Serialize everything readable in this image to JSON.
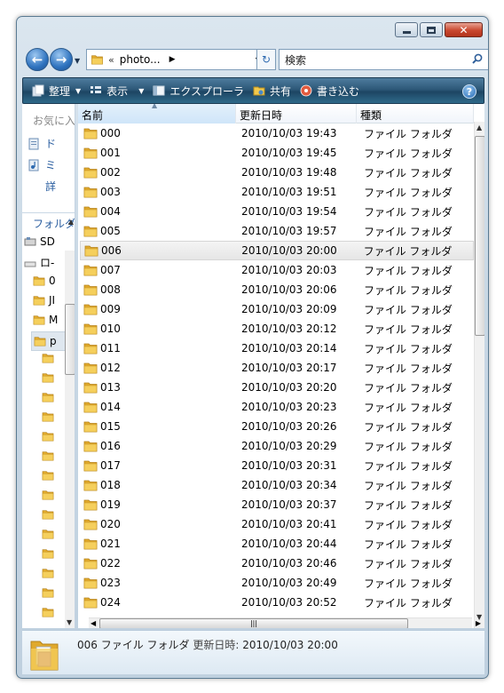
{
  "window": {
    "caption_buttons": [
      "minimize-icon",
      "maximize-icon",
      "close-icon"
    ]
  },
  "nav": {
    "address_chevron": "«",
    "address_path": "photo...",
    "search_placeholder": "検索"
  },
  "toolbar": {
    "organize": "整理",
    "views": "表示",
    "explorer": "エクスプローラ",
    "share": "共有",
    "burn": "書き込む",
    "help": "?"
  },
  "left": {
    "favorites_head": "お気に入",
    "favorites": [
      {
        "label": "ド",
        "icon": "documents-icon"
      },
      {
        "label": "ミ",
        "icon": "music-icon"
      },
      {
        "label": "詳",
        "icon": ""
      }
    ],
    "folders_head": "フォルダ",
    "tree": [
      {
        "label": "SD"
      },
      {
        "label": "ロ-"
      },
      {
        "label": "0"
      },
      {
        "label": "JI"
      },
      {
        "label": "M"
      },
      {
        "label": "p"
      }
    ]
  },
  "columns": {
    "name": "名前",
    "date": "更新日時",
    "type": "種類"
  },
  "rows": [
    {
      "name": "000",
      "date": "2010/10/03 19:43",
      "type": "ファイル フォルダ"
    },
    {
      "name": "001",
      "date": "2010/10/03 19:45",
      "type": "ファイル フォルダ"
    },
    {
      "name": "002",
      "date": "2010/10/03 19:48",
      "type": "ファイル フォルダ"
    },
    {
      "name": "003",
      "date": "2010/10/03 19:51",
      "type": "ファイル フォルダ"
    },
    {
      "name": "004",
      "date": "2010/10/03 19:54",
      "type": "ファイル フォルダ"
    },
    {
      "name": "005",
      "date": "2010/10/03 19:57",
      "type": "ファイル フォルダ"
    },
    {
      "name": "006",
      "date": "2010/10/03 20:00",
      "type": "ファイル フォルダ",
      "selected": true
    },
    {
      "name": "007",
      "date": "2010/10/03 20:03",
      "type": "ファイル フォルダ"
    },
    {
      "name": "008",
      "date": "2010/10/03 20:06",
      "type": "ファイル フォルダ"
    },
    {
      "name": "009",
      "date": "2010/10/03 20:09",
      "type": "ファイル フォルダ"
    },
    {
      "name": "010",
      "date": "2010/10/03 20:12",
      "type": "ファイル フォルダ"
    },
    {
      "name": "011",
      "date": "2010/10/03 20:14",
      "type": "ファイル フォルダ"
    },
    {
      "name": "012",
      "date": "2010/10/03 20:17",
      "type": "ファイル フォルダ"
    },
    {
      "name": "013",
      "date": "2010/10/03 20:20",
      "type": "ファイル フォルダ"
    },
    {
      "name": "014",
      "date": "2010/10/03 20:23",
      "type": "ファイル フォルダ"
    },
    {
      "name": "015",
      "date": "2010/10/03 20:26",
      "type": "ファイル フォルダ"
    },
    {
      "name": "016",
      "date": "2010/10/03 20:29",
      "type": "ファイル フォルダ"
    },
    {
      "name": "017",
      "date": "2010/10/03 20:31",
      "type": "ファイル フォルダ"
    },
    {
      "name": "018",
      "date": "2010/10/03 20:34",
      "type": "ファイル フォルダ"
    },
    {
      "name": "019",
      "date": "2010/10/03 20:37",
      "type": "ファイル フォルダ"
    },
    {
      "name": "020",
      "date": "2010/10/03 20:41",
      "type": "ファイル フォルダ"
    },
    {
      "name": "021",
      "date": "2010/10/03 20:44",
      "type": "ファイル フォルダ"
    },
    {
      "name": "022",
      "date": "2010/10/03 20:46",
      "type": "ファイル フォルダ"
    },
    {
      "name": "023",
      "date": "2010/10/03 20:49",
      "type": "ファイル フォルダ"
    },
    {
      "name": "024",
      "date": "2010/10/03 20:52",
      "type": "ファイル フォルダ"
    }
  ],
  "details": {
    "name": "006",
    "type": "ファイル フォルダ",
    "modified_label": "更新日時:",
    "modified_value": "2010/10/03 20:00"
  },
  "colors": {
    "folder": "#e8b83c",
    "toolbar": "#2d5878",
    "link": "#2a5ea0"
  }
}
